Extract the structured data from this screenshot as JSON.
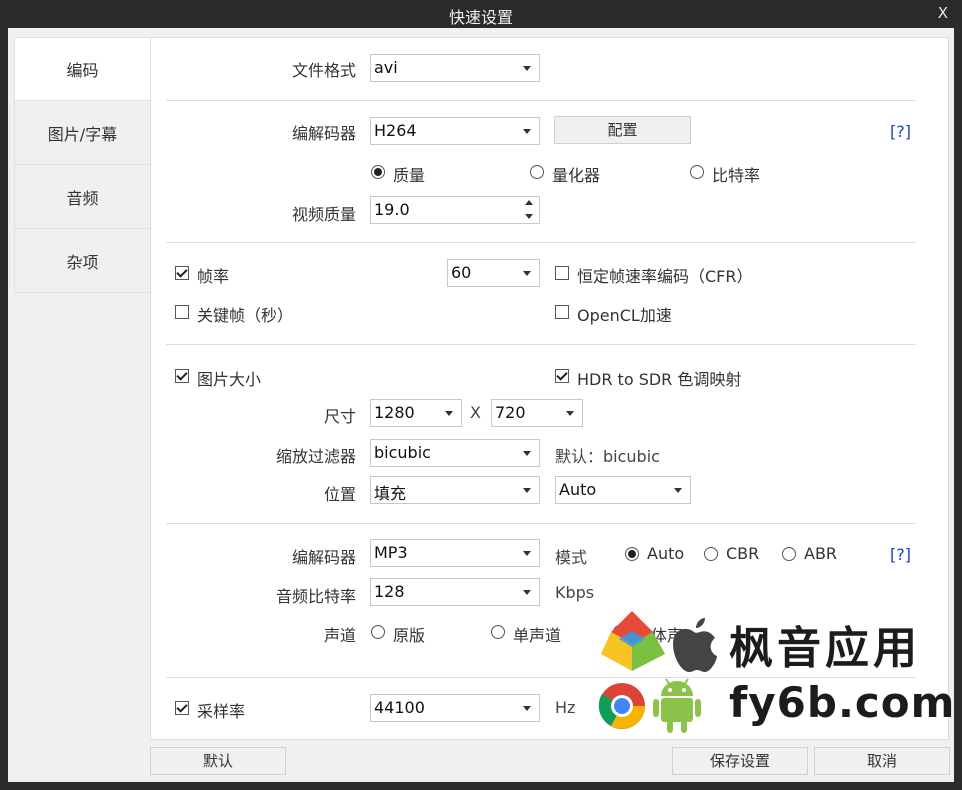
{
  "window": {
    "title": "快速设置",
    "close_label": "X"
  },
  "sidebar": {
    "items": [
      {
        "label": "编码",
        "active": true
      },
      {
        "label": "图片/字幕",
        "active": false
      },
      {
        "label": "音频",
        "active": false
      },
      {
        "label": "杂项",
        "active": false
      }
    ]
  },
  "format": {
    "label": "文件格式",
    "value": "avi"
  },
  "video": {
    "codec_label": "编解码器",
    "codec_value": "H264",
    "config_button": "配置",
    "help": "[?]",
    "mode_options": [
      "质量",
      "量化器",
      "比特率"
    ],
    "mode_selected": 0,
    "quality_label": "视频质量",
    "quality_value": "19.0"
  },
  "framerate": {
    "fps_label": "帧率",
    "fps_checked": true,
    "fps_value": "60",
    "cfr_label": "恒定帧速率编码（CFR）",
    "cfr_checked": false,
    "keyframe_label": "关键帧（秒）",
    "keyframe_checked": false,
    "opencl_label": "OpenCL加速",
    "opencl_checked": false
  },
  "picture": {
    "size_label": "图片大小",
    "size_checked": true,
    "hdr_label": "HDR to SDR 色调映射",
    "hdr_checked": true,
    "dim_label": "尺寸",
    "width": "1280",
    "x_sep": "X",
    "height": "720",
    "filter_label": "缩放过滤器",
    "filter_value": "bicubic",
    "filter_default": "默认：bicubic",
    "position_label": "位置",
    "position_value": "填充",
    "position_value2": "Auto"
  },
  "audio": {
    "codec_label": "编解码器",
    "codec_value": "MP3",
    "mode_label": "模式",
    "mode_options": [
      "Auto",
      "CBR",
      "ABR"
    ],
    "mode_selected": 0,
    "help": "[?]",
    "bitrate_label": "音频比特率",
    "bitrate_value": "128",
    "bitrate_unit": "Kbps",
    "channel_label": "声道",
    "channel_options": [
      "原版",
      "单声道",
      "立体声"
    ],
    "channel_selected": 2
  },
  "sample": {
    "label": "采样率",
    "checked": true,
    "value": "44100",
    "unit": "Hz"
  },
  "footer": {
    "default_button": "默认",
    "save_button": "保存设置",
    "cancel_button": "取消"
  },
  "watermark": {
    "line1": "枫音应用",
    "line2": "fy6b.com"
  }
}
